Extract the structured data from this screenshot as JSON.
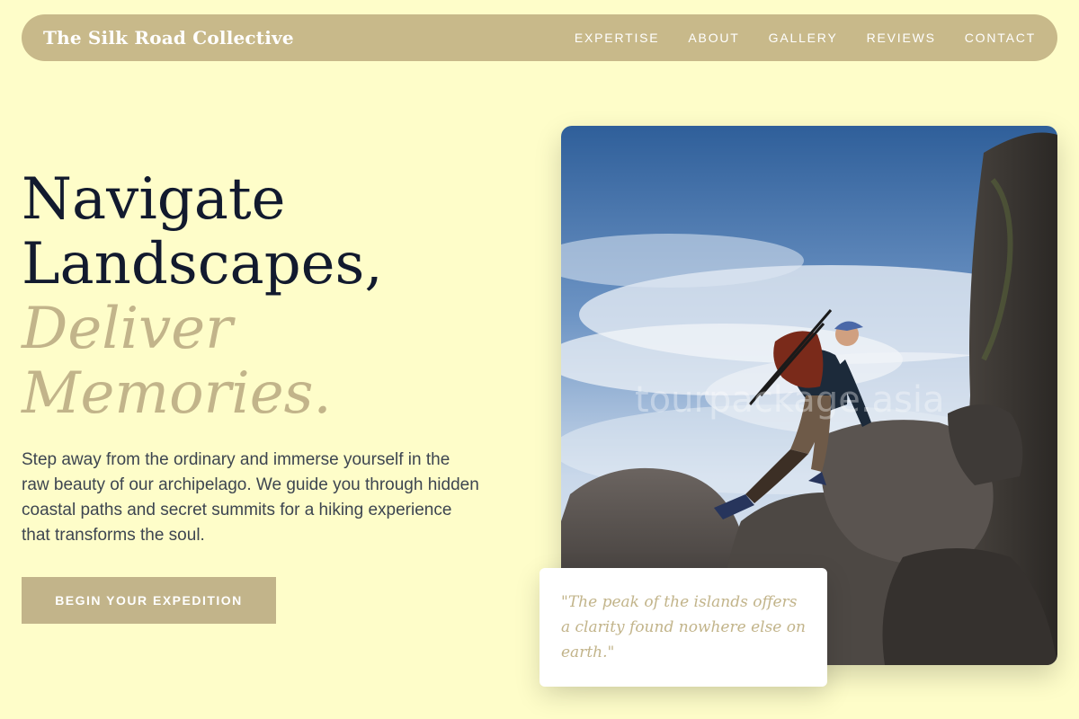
{
  "header": {
    "brand": "The Silk Road Collective",
    "nav": [
      {
        "label": "EXPERTISE"
      },
      {
        "label": "ABOUT"
      },
      {
        "label": "GALLERY"
      },
      {
        "label": "REVIEWS"
      },
      {
        "label": "CONTACT"
      }
    ]
  },
  "hero": {
    "headline_line1": "Navigate",
    "headline_line2": "Landscapes,",
    "headline_accent_line1": "Deliver",
    "headline_accent_line2": "Memories.",
    "intro": "Step away from the ordinary and immerse yourself in the raw beauty of our archipelago. We guide you through hidden coastal paths and secret summits for a hiking experience that transforms the soul.",
    "cta_label": "BEGIN YOUR EXPEDITION",
    "image_watermark": "tourpackage.asia",
    "quote": "\"The peak of the islands offers a clarity found nowhere else on earth.\""
  },
  "colors": {
    "background": "#fefdc9",
    "brand_gold": "#c8b98a",
    "accent_gold": "#c2b48a",
    "heading_navy": "#121a2e",
    "body_text": "#3d4550"
  }
}
